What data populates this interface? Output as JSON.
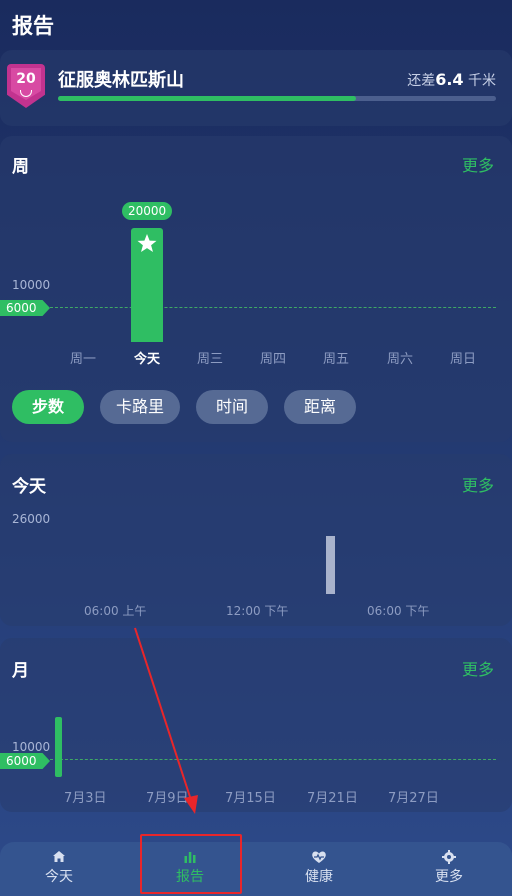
{
  "header": {
    "title": "报告"
  },
  "goal": {
    "badge_number": "20",
    "title": "征服奥林匹斯山",
    "remain_prefix": "还差",
    "remain_value": "6.4",
    "remain_unit": " 千米",
    "progress": 0.68
  },
  "week": {
    "title": "周",
    "more": "更多",
    "ytick": "10000",
    "goal_tag": "6000",
    "bar_value_label": "20000",
    "days": [
      "周一",
      "今天",
      "周三",
      "周四",
      "周五",
      "周六",
      "周日"
    ],
    "active_day": 1,
    "metrics": [
      "步数",
      "卡路里",
      "时间",
      "距离"
    ],
    "active_metric": 0
  },
  "today": {
    "title": "今天",
    "more": "更多",
    "ytick": "26000",
    "times": [
      "06:00 上午",
      "12:00 下午",
      "06:00 下午"
    ]
  },
  "month": {
    "title": "月",
    "more": "更多",
    "ytick": "10000",
    "goal_tag": "6000",
    "dates": [
      "7月3日",
      "7月9日",
      "7月15日",
      "7月21日",
      "7月27日"
    ]
  },
  "tabbar": {
    "tabs": [
      "今天",
      "报告",
      "健康",
      "更多"
    ],
    "active": 1,
    "icons": [
      "home-icon",
      "bar-chart-icon",
      "heart-pulse-icon",
      "gear-icon"
    ]
  },
  "colors": {
    "accent": "#2fbe63",
    "badge": "#c2338f",
    "highlight": "#e8262a"
  }
}
